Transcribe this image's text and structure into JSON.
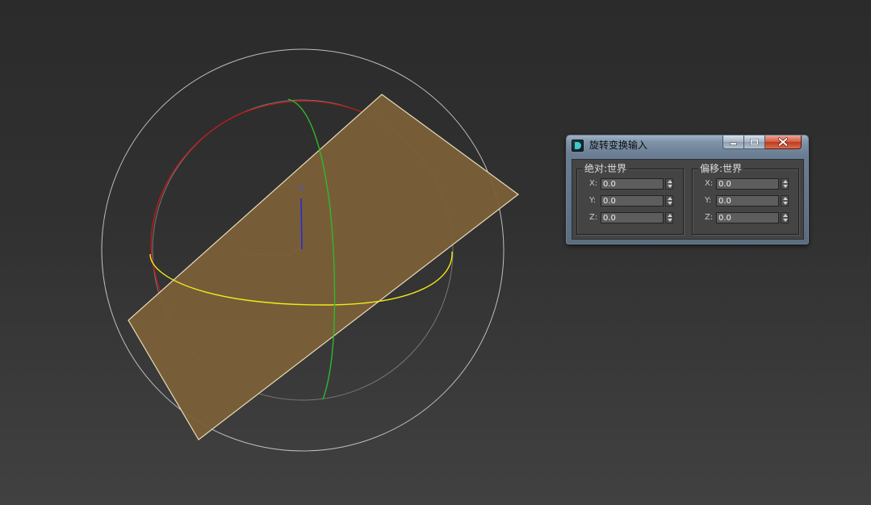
{
  "viewport": {
    "axis_label": "z",
    "colors": {
      "background_top": "#2b2b2b",
      "background_bottom": "#414141",
      "gizmo_outer_circle": "#bdbdbd",
      "gizmo_inner_circle": "#777777",
      "x_axis_ring": "#c0191c",
      "y_axis_ring": "#2fb82c",
      "z_axis_ring": "#f2ea18",
      "z_axis_line": "#2b2bd6",
      "plane_fill": "#7a6039",
      "plane_edge": "#e8dcb8"
    }
  },
  "dialog": {
    "title": "旋转变换输入",
    "icon": "3dsmax-app-icon",
    "window_buttons": {
      "minimize": "minimize-icon",
      "maximize": "maximize-icon",
      "close": "close-icon"
    },
    "absolute_group": {
      "label": "绝对:世界",
      "rows": [
        {
          "label": "X:",
          "value": "0.0"
        },
        {
          "label": "Y:",
          "value": "0.0"
        },
        {
          "label": "Z:",
          "value": "0.0"
        }
      ]
    },
    "offset_group": {
      "label": "偏移:世界",
      "rows": [
        {
          "label": "X:",
          "value": "0.0"
        },
        {
          "label": "Y:",
          "value": "0.0"
        },
        {
          "label": "Z:",
          "value": "0.0"
        }
      ]
    }
  }
}
